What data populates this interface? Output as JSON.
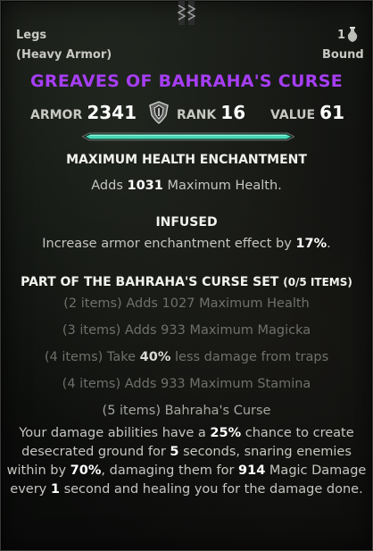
{
  "header": {
    "slot": "Legs",
    "armor_type": "(Heavy Armor)",
    "count": "1",
    "bind": "Bound",
    "bag_icon": "potion-bag-icon"
  },
  "item": {
    "name": "GREAVES OF BAHRAHA'S CURSE",
    "name_color": "#a63ef4"
  },
  "stats": {
    "armor_label": "ARMOR",
    "armor_value": "2341",
    "rank_icon": "shield-rank-icon",
    "rank_label": "RANK",
    "rank_value": "16",
    "value_label": "VALUE",
    "value_value": "61"
  },
  "charge_bar": {
    "fill": 1.0,
    "color": "#48d9b6"
  },
  "enchantment": {
    "title": "MAXIMUM HEALTH ENCHANTMENT",
    "pre": "Adds",
    "amount": "1031",
    "post": "Maximum Health."
  },
  "trait": {
    "title": "INFUSED",
    "pre": "Increase armor enchantment effect by",
    "amount": "17%",
    "post": "."
  },
  "set": {
    "title": "PART OF THE BAHRAHA'S CURSE SET",
    "count": "(0/5 ITEMS)",
    "bonus_2": "(2 items) Adds 1027 Maximum Health",
    "bonus_3": "(3 items) Adds 933 Maximum Magicka",
    "bonus_4a_pre": "(4 items) Take",
    "bonus_4a_pct": "40%",
    "bonus_4a_post": "less damage from traps",
    "bonus_4b": "(4 items) Adds 933 Maximum Stamina",
    "bonus_5_title": "(5 items) Bahraha's Curse",
    "bonus_5": {
      "l1_pre": "Your damage abilities have a",
      "l1_pct": "25%",
      "l1_post": "chance to create",
      "l2_pre": "desecrated ground for",
      "l2_num": "5",
      "l2_post": "seconds, snaring enemies",
      "l3_pre": "within by",
      "l3_pct": "70%",
      "l3_mid": ", damaging them for",
      "l3_num": "914",
      "l3_post": "Magic Damage",
      "l4_pre": "every",
      "l4_num": "1",
      "l4_post": "second and healing you for the damage done."
    }
  }
}
